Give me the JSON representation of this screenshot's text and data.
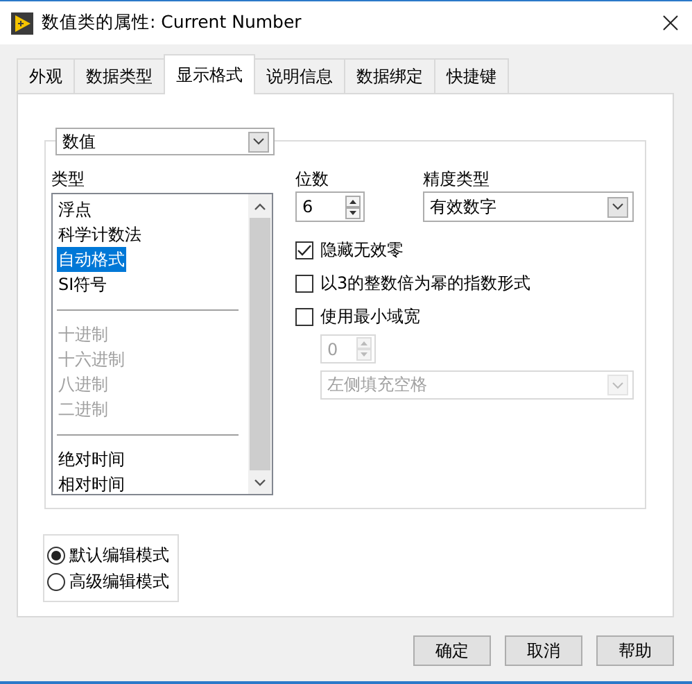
{
  "window": {
    "title": "数值类的属性: Current Number"
  },
  "tabs": [
    {
      "label": "外观",
      "selected": false
    },
    {
      "label": "数据类型",
      "selected": false
    },
    {
      "label": "显示格式",
      "selected": true
    },
    {
      "label": "说明信息",
      "selected": false
    },
    {
      "label": "数据绑定",
      "selected": false
    },
    {
      "label": "快捷键",
      "selected": false
    }
  ],
  "format_dropdown": {
    "value": "数值"
  },
  "type_list": {
    "label": "类型",
    "items": [
      {
        "kind": "item",
        "label": "浮点",
        "selected": false,
        "disabled": false
      },
      {
        "kind": "item",
        "label": "科学计数法",
        "selected": false,
        "disabled": false
      },
      {
        "kind": "item",
        "label": "自动格式",
        "selected": true,
        "disabled": false
      },
      {
        "kind": "item",
        "label": "SI符号",
        "selected": false,
        "disabled": false
      },
      {
        "kind": "separator"
      },
      {
        "kind": "item",
        "label": "十进制",
        "selected": false,
        "disabled": true
      },
      {
        "kind": "item",
        "label": "十六进制",
        "selected": false,
        "disabled": true
      },
      {
        "kind": "item",
        "label": "八进制",
        "selected": false,
        "disabled": true
      },
      {
        "kind": "item",
        "label": "二进制",
        "selected": false,
        "disabled": true
      },
      {
        "kind": "separator"
      },
      {
        "kind": "item",
        "label": "绝对时间",
        "selected": false,
        "disabled": false
      },
      {
        "kind": "item",
        "label": "相对时间",
        "selected": false,
        "disabled": false
      }
    ]
  },
  "digits": {
    "label": "位数",
    "value": "6"
  },
  "precision": {
    "label": "精度类型",
    "value": "有效数字"
  },
  "options": [
    {
      "label": "隐藏无效零",
      "checked": true
    },
    {
      "label": "以3的整数倍为幂的指数形式",
      "checked": false
    },
    {
      "label": "使用最小域宽",
      "checked": false
    }
  ],
  "min_width": {
    "value": "0",
    "disabled": true
  },
  "padding": {
    "value": "左侧填充空格",
    "disabled": true
  },
  "edit_modes": [
    {
      "label": "默认编辑模式",
      "selected": true
    },
    {
      "label": "高级编辑模式",
      "selected": false
    }
  ],
  "buttons": [
    "确定",
    "取消",
    "帮助"
  ]
}
